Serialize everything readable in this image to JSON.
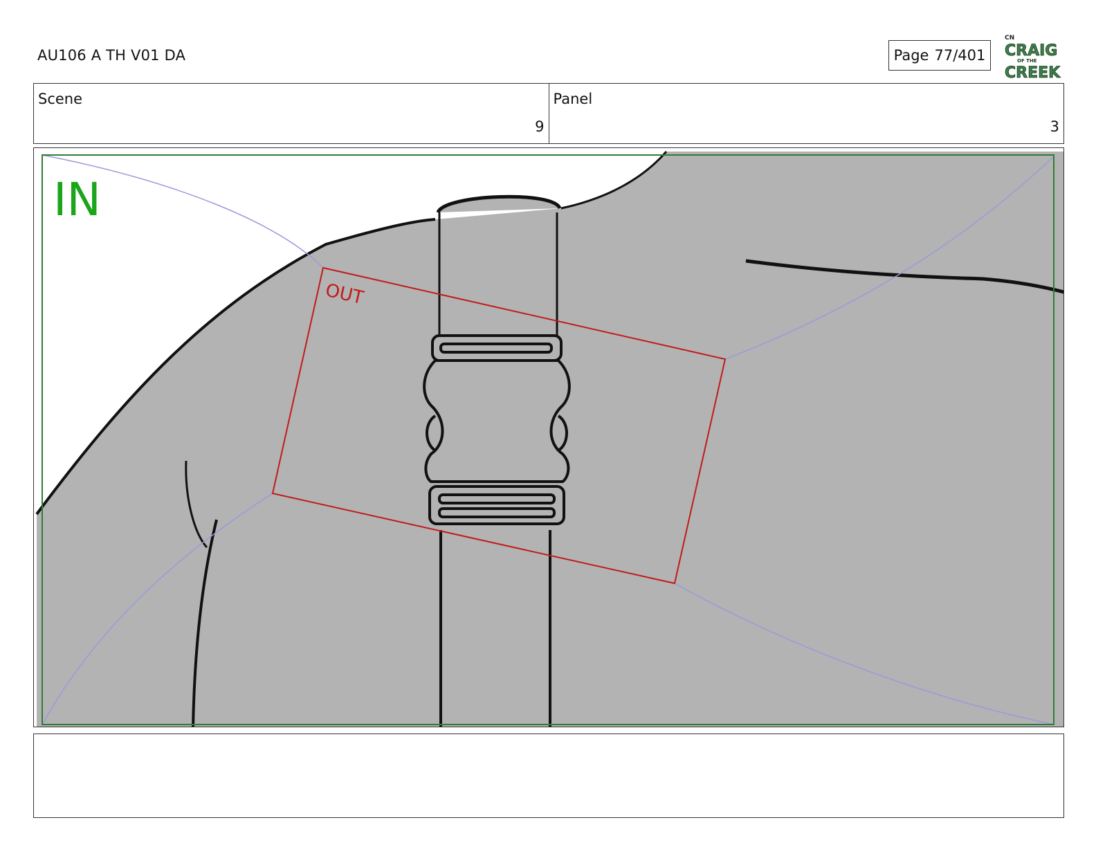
{
  "header": {
    "document_title": "AU106 A TH V01 DA",
    "page_label": "Page",
    "page_value": "77/401",
    "logo_lines": [
      "CN",
      "CRAIG",
      "OF THE",
      "CREEK"
    ]
  },
  "info": {
    "scene_label": "Scene",
    "scene_value": "9",
    "panel_label": "Panel",
    "panel_value": "3"
  },
  "panel": {
    "in_label": "IN",
    "out_label": "OUT",
    "colors": {
      "fill": "#b3b3b3",
      "line": "#111111",
      "in_frame": "#2e7d32",
      "in_text": "#1aa51a",
      "out_frame": "#c21a1a",
      "guide": "#9a9adc"
    }
  },
  "notes": {
    "text": ""
  }
}
